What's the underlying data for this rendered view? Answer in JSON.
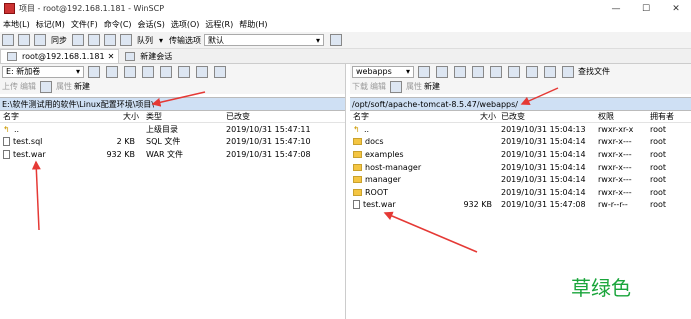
{
  "window": {
    "title": "项目 - root@192.168.1.181 - WinSCP",
    "min": "—",
    "max": "☐",
    "close": "✕"
  },
  "menu": [
    "本地(L)",
    "标记(M)",
    "文件(F)",
    "命令(C)",
    "会话(S)",
    "选项(O)",
    "远程(R)",
    "帮助(H)"
  ],
  "toolbar": {
    "sync": "同步",
    "queue": "队列",
    "transfer_label": "传输选项",
    "transfer_value": "默认"
  },
  "tabs": [
    {
      "label": "root@192.168.1.181"
    },
    {
      "label": "新建会话"
    }
  ],
  "left": {
    "drive": "E: 新加卷",
    "tools": {
      "upload": "上传",
      "edit": "编辑",
      "props": "属性",
      "new": "新建"
    },
    "path": "E:\\软件测试用的软件\\Linux配置环境\\项目\\",
    "columns": {
      "name": "名字",
      "size": "大小",
      "type": "类型",
      "changed": "已改变"
    },
    "rows": [
      {
        "name": "..",
        "size": "",
        "type": "上级目录",
        "changed": "2019/10/31  15:47:11",
        "icon": "up"
      },
      {
        "name": "test.sql",
        "size": "2 KB",
        "type": "SQL 文件",
        "changed": "2019/10/31  15:47:10",
        "icon": "doc"
      },
      {
        "name": "test.war",
        "size": "932 KB",
        "type": "WAR 文件",
        "changed": "2019/10/31  15:47:08",
        "icon": "doc"
      }
    ]
  },
  "right": {
    "folder": "webapps",
    "find": "查找文件",
    "tools": {
      "download": "下载",
      "edit": "编辑",
      "props": "属性",
      "new": "新建"
    },
    "path": "/opt/soft/apache-tomcat-8.5.47/webapps/",
    "columns": {
      "name": "名字",
      "size": "大小",
      "changed": "已改变",
      "rights": "权限",
      "owner": "拥有者"
    },
    "rows": [
      {
        "name": "..",
        "size": "",
        "changed": "2019/10/31  15:04:13",
        "rights": "rwxr-xr-x",
        "owner": "root",
        "icon": "up"
      },
      {
        "name": "docs",
        "size": "",
        "changed": "2019/10/31  15:04:14",
        "rights": "rwxr-x---",
        "owner": "root",
        "icon": "folder"
      },
      {
        "name": "examples",
        "size": "",
        "changed": "2019/10/31  15:04:14",
        "rights": "rwxr-x---",
        "owner": "root",
        "icon": "folder"
      },
      {
        "name": "host-manager",
        "size": "",
        "changed": "2019/10/31  15:04:14",
        "rights": "rwxr-x---",
        "owner": "root",
        "icon": "folder"
      },
      {
        "name": "manager",
        "size": "",
        "changed": "2019/10/31  15:04:14",
        "rights": "rwxr-x---",
        "owner": "root",
        "icon": "folder"
      },
      {
        "name": "ROOT",
        "size": "",
        "changed": "2019/10/31  15:04:14",
        "rights": "rwxr-x---",
        "owner": "root",
        "icon": "folder"
      },
      {
        "name": "test.war",
        "size": "932 KB",
        "changed": "2019/10/31  15:47:08",
        "rights": "rw-r--r--",
        "owner": "root",
        "icon": "doc"
      }
    ]
  },
  "watermark": "草绿色",
  "colors": {
    "path_bg": "#cfe0f4",
    "arrow": "#e53935",
    "watermark": "#1aa53b"
  }
}
